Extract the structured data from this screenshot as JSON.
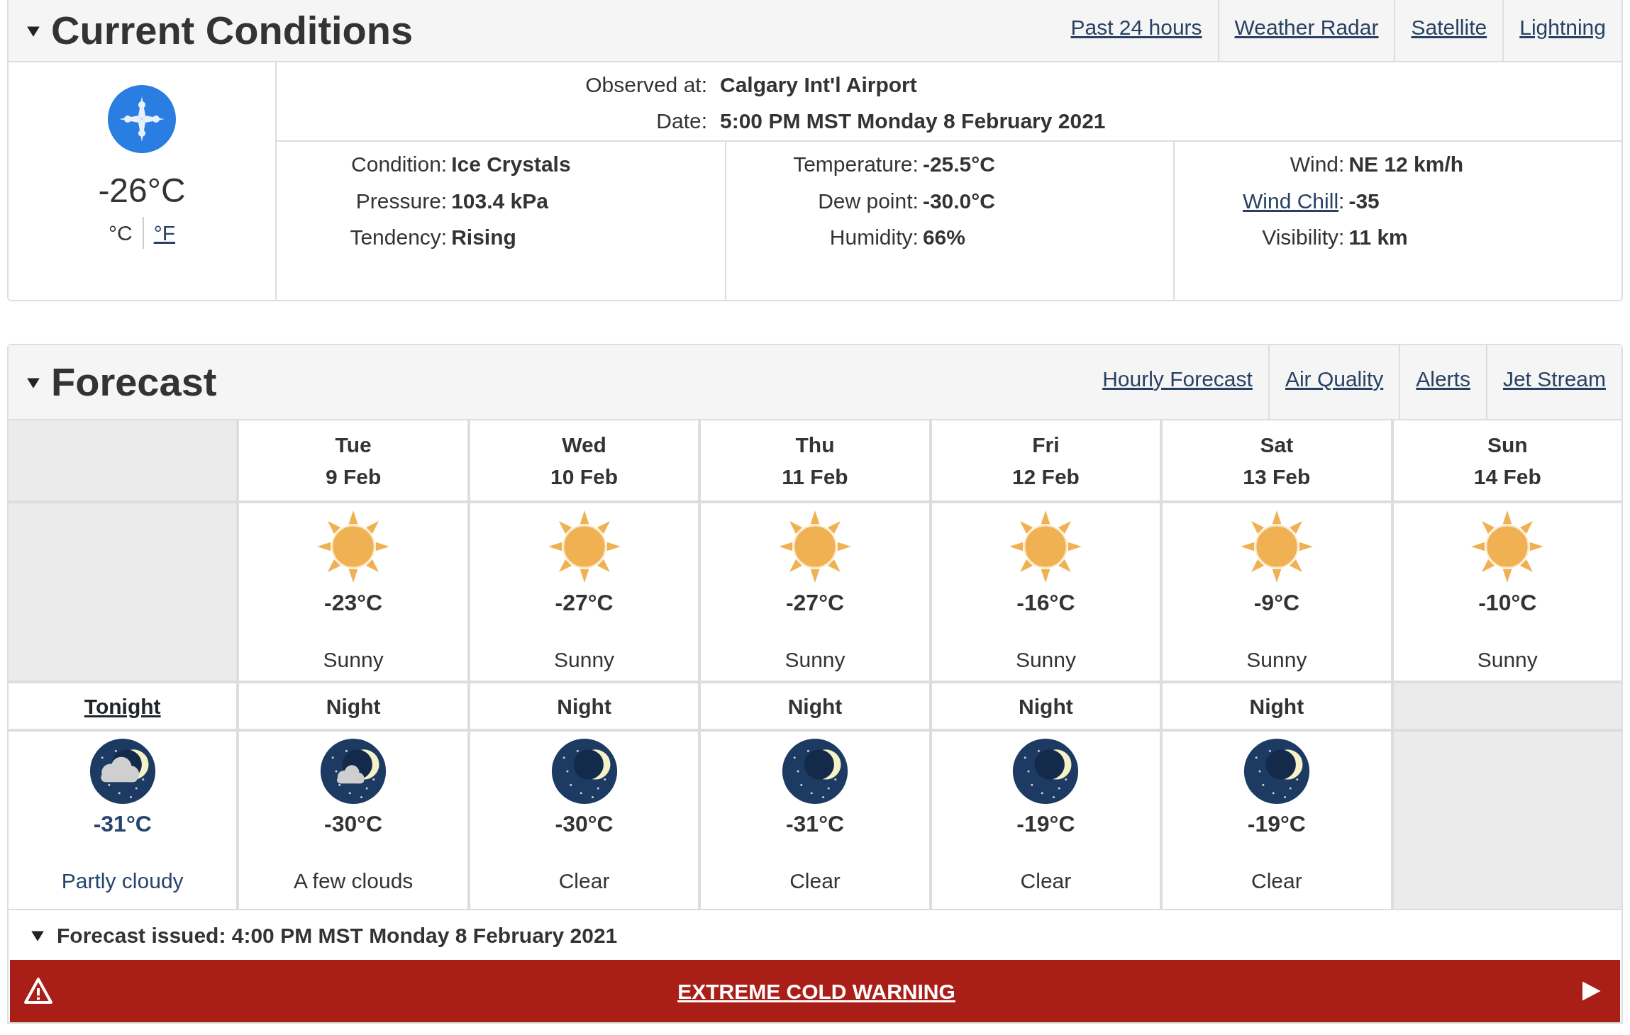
{
  "current": {
    "title": "Current Conditions",
    "links": [
      "Past 24 hours",
      "Weather Radar",
      "Satellite",
      "Lightning"
    ],
    "temperature": "-26°C",
    "units": [
      {
        "label": "°C",
        "selected": true
      },
      {
        "label": "°F",
        "selected": false
      }
    ],
    "observed": [
      {
        "label": "Observed at:",
        "value": "Calgary Int'l Airport"
      },
      {
        "label": "Date:",
        "value": "5:00 PM MST Monday 8 February 2021"
      }
    ],
    "details": [
      [
        {
          "label": "Condition:",
          "value": "Ice Crystals",
          "link": false
        },
        {
          "label": "Pressure:",
          "value": "103.4 kPa",
          "link": false
        },
        {
          "label": "Tendency:",
          "value": "Rising",
          "link": false
        }
      ],
      [
        {
          "label": "Temperature:",
          "value": "-25.5°C",
          "link": false
        },
        {
          "label": "Dew point:",
          "value": "-30.0°C",
          "link": false
        },
        {
          "label": "Humidity:",
          "value": "66%",
          "link": false
        }
      ],
      [
        {
          "label": "Wind:",
          "value": "NE 12 km/h",
          "link": false
        },
        {
          "label": "Wind Chill",
          "suffix": ":",
          "value": "-35",
          "link": true
        },
        {
          "label": "Visibility:",
          "value": "11 km",
          "link": false
        }
      ]
    ]
  },
  "forecast": {
    "title": "Forecast",
    "links": [
      "Hourly Forecast",
      "Air Quality",
      "Alerts",
      "Jet Stream"
    ],
    "days": [
      {
        "day": "Tue",
        "date": "9 Feb",
        "kind": "sun",
        "temp": "-23°C",
        "condition": "Sunny"
      },
      {
        "day": "Wed",
        "date": "10 Feb",
        "kind": "sun",
        "temp": "-27°C",
        "condition": "Sunny"
      },
      {
        "day": "Thu",
        "date": "11 Feb",
        "kind": "sun",
        "temp": "-27°C",
        "condition": "Sunny"
      },
      {
        "day": "Fri",
        "date": "12 Feb",
        "kind": "sun",
        "temp": "-16°C",
        "condition": "Sunny"
      },
      {
        "day": "Sat",
        "date": "13 Feb",
        "kind": "sun",
        "temp": "-9°C",
        "condition": "Sunny"
      },
      {
        "day": "Sun",
        "date": "14 Feb",
        "kind": "sun",
        "temp": "-10°C",
        "condition": "Sunny"
      }
    ],
    "nights": [
      {
        "label": "Tonight",
        "current": true,
        "kind": "partly-cloudy",
        "temp": "-31°C",
        "condition": "Partly cloudy"
      },
      {
        "label": "Night",
        "current": false,
        "kind": "few-clouds",
        "temp": "-30°C",
        "condition": "A few clouds"
      },
      {
        "label": "Night",
        "current": false,
        "kind": "clear",
        "temp": "-30°C",
        "condition": "Clear"
      },
      {
        "label": "Night",
        "current": false,
        "kind": "clear",
        "temp": "-31°C",
        "condition": "Clear"
      },
      {
        "label": "Night",
        "current": false,
        "kind": "clear",
        "temp": "-19°C",
        "condition": "Clear"
      },
      {
        "label": "Night",
        "current": false,
        "kind": "clear",
        "temp": "-19°C",
        "condition": "Clear"
      }
    ],
    "issued": "Forecast issued: 4:00 PM MST Monday 8 February 2021",
    "warning": "EXTREME COLD WARNING"
  }
}
